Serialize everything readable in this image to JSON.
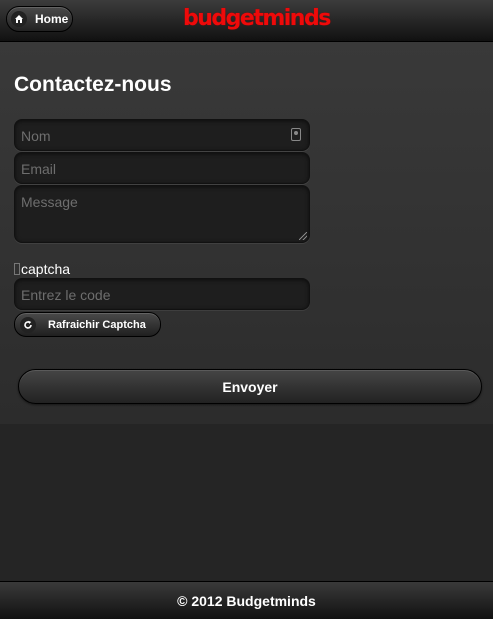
{
  "header": {
    "home_label": "Home",
    "logo_text": "budgetminds",
    "brand_color": "#ee0a0a"
  },
  "page": {
    "title": "Contactez-nous"
  },
  "form": {
    "nom_placeholder": "Nom",
    "email_placeholder": "Email",
    "message_placeholder": "Message",
    "captcha_alt": "captcha",
    "code_placeholder": "Entrez le code",
    "refresh_label": "Rafraichir Captcha",
    "submit_label": "Envoyer"
  },
  "icons": {
    "home": "home-icon",
    "contact_card": "contact-card-icon",
    "refresh": "refresh-icon",
    "broken_image": "broken-image-icon"
  },
  "footer": {
    "text": "© 2012 Budgetminds"
  }
}
